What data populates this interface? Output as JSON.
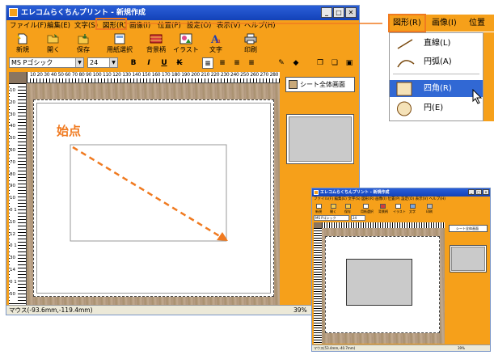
{
  "main": {
    "title": "エレコムらくちんプリント - 新規作成",
    "menu": [
      "ファイル(F)",
      "編集(E)",
      "文字(S)",
      "図形(R)",
      "画像(I)",
      "位置(P)",
      "設定(O)",
      "表示(V)",
      "ヘルプ(H)"
    ],
    "toolbar": [
      "新規",
      "開く",
      "保存",
      "用紙選択",
      "背景柄",
      "イラスト",
      "文字",
      "印刷"
    ],
    "font_name": "MS Pゴシック",
    "font_size": "24",
    "format_buttons": [
      "B",
      "I",
      "U",
      "K"
    ],
    "ruler_label": "10 20 30 40 50 60 70 80 90 100 110 120 130 140 150 160 170 180 190 200 210 220 230 240 250 260 270 280 290",
    "ruler_v": "10 20 30 40 50 60 70 80 90 100 110 120 130 140 150 160 170",
    "annotation": "始点",
    "side_button": "シート全体画面",
    "status_mouse": "マウス(-93.6mm,-119.4mm)",
    "status_zoom": "39%"
  },
  "popup_menu": {
    "header": [
      "図形(R)",
      "画像(I)",
      "位置"
    ],
    "items": [
      "直線(L)",
      "円弧(A)",
      "四角(R)",
      "円(E)"
    ],
    "selected": "四角(R)"
  },
  "thumb": {
    "title": "エレコムらくちんプリント - 新規作成",
    "menu": "ファイル(F) 編集(E) 文字(S) 図形(R) 画像(I) 位置(P) 設定(O) 表示(V) ヘルプ(H)",
    "toolbar": [
      "新規",
      "開く",
      "保存",
      "用紙選択",
      "背景柄",
      "イラスト",
      "文字",
      "印刷"
    ],
    "font_name": "MS Pゴシック",
    "font_size": "24",
    "side_button": "シート全体画面",
    "status_mouse": "マウス(53.4mm,-40.7mm)",
    "status_zoom": "39%"
  },
  "colors": {
    "accent": "#f6a01a",
    "callout": "#f07a20",
    "title": "#1d4fc4",
    "highlight": "#3168d4"
  }
}
